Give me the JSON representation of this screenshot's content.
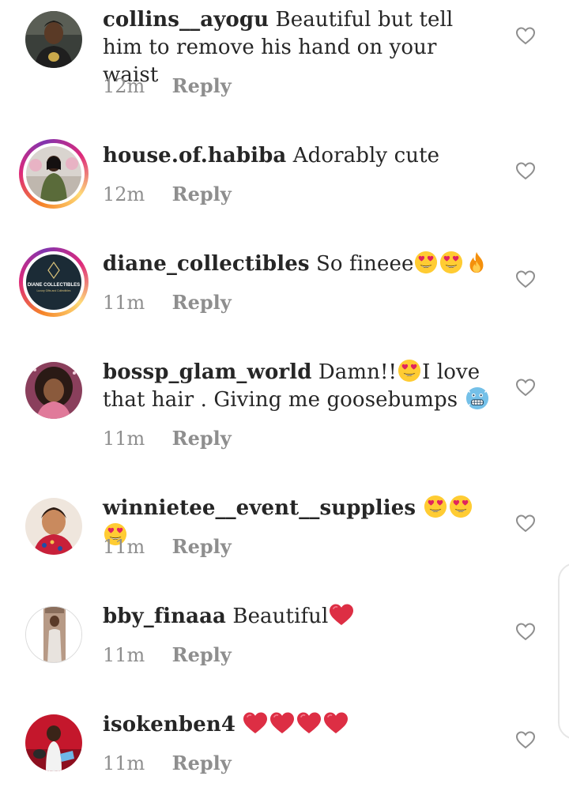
{
  "comments": [
    {
      "username": "collins__ayogu",
      "text": "Beautiful but tell him to remove his hand on your waist",
      "time": "12m",
      "reply_label": "Reply",
      "avatar": "photo-man-dark-background",
      "has_story_ring": false
    },
    {
      "username": "house.of.habiba",
      "text": "Adorably cute",
      "time": "12m",
      "reply_label": "Reply",
      "avatar": "photo-woman-green-outfit",
      "has_story_ring": true
    },
    {
      "username": "diane_collectibles",
      "text": "So fineee",
      "emojis": [
        "heart-eyes-emoji",
        "heart-eyes-emoji",
        "fire-emoji"
      ],
      "time": "11m",
      "reply_label": "Reply",
      "avatar": "logo-diane-collectibles",
      "has_story_ring": true
    },
    {
      "username": "bossp_glam_world",
      "text_before_emoji": "Damn!!",
      "text_after_emoji": "I love that hair . Giving me goosebumps",
      "emojis": [
        "heart-eyes-emoji",
        "cold-face-emoji"
      ],
      "time": "11m",
      "reply_label": "Reply",
      "avatar": "photo-woman-curly-hair",
      "has_story_ring": false
    },
    {
      "username": "winnietee__event__supplies",
      "text": "",
      "emojis": [
        "heart-eyes-emoji",
        "heart-eyes-emoji",
        "heart-eyes-emoji"
      ],
      "time": "11m",
      "reply_label": "Reply",
      "avatar": "photo-woman-red-outfit",
      "has_story_ring": false
    },
    {
      "username": "bby_finaaa",
      "text": "Beautiful",
      "emojis": [
        "red-heart-emoji"
      ],
      "time": "11m",
      "reply_label": "Reply",
      "avatar": "photo-woman-standing",
      "has_story_ring": false
    },
    {
      "username": "isokenben4",
      "text": "",
      "emojis": [
        "red-heart-emoji",
        "red-heart-emoji",
        "red-heart-emoji",
        "red-heart-emoji"
      ],
      "time": "11m",
      "reply_label": "Reply",
      "avatar": "photo-woman-red-car",
      "has_story_ring": false
    }
  ],
  "logo_text": {
    "line1": "DIANE COLLECTIBLES",
    "line2": "Luxury Gifts and Collectibles"
  },
  "colors": {
    "text": "#262626",
    "muted": "#8e8e8e",
    "heart_outline": "#8e8e8e",
    "emoji_red": "#e0245e",
    "emoji_yellow": "#ffcc33"
  }
}
